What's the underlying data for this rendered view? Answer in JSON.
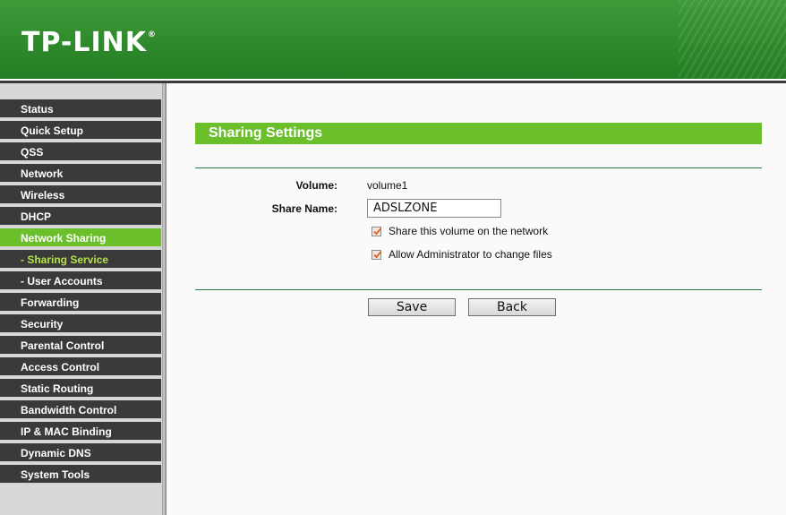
{
  "brand": {
    "logo_text": "TP-LINK",
    "registered": "®"
  },
  "sidebar": {
    "items": [
      {
        "label": "Status"
      },
      {
        "label": "Quick Setup"
      },
      {
        "label": "QSS"
      },
      {
        "label": "Network"
      },
      {
        "label": "Wireless"
      },
      {
        "label": "DHCP"
      },
      {
        "label": "Network Sharing",
        "state": "active"
      },
      {
        "label": "- Sharing Service",
        "state": "selected-sub"
      },
      {
        "label": "- User Accounts"
      },
      {
        "label": "Forwarding"
      },
      {
        "label": "Security"
      },
      {
        "label": "Parental Control"
      },
      {
        "label": "Access Control"
      },
      {
        "label": "Static Routing"
      },
      {
        "label": "Bandwidth Control"
      },
      {
        "label": "IP & MAC Binding"
      },
      {
        "label": "Dynamic DNS"
      },
      {
        "label": "System Tools"
      }
    ]
  },
  "main": {
    "title": "Sharing Settings",
    "volume_label": "Volume:",
    "volume_value": "volume1",
    "share_name_label": "Share Name:",
    "share_name_value": "ADSLZONE",
    "share_volume_checkbox": {
      "label": "Share this volume on the network",
      "checked": true
    },
    "allow_admin_checkbox": {
      "label": "Allow Administrator to change files",
      "checked": true
    },
    "save_label": "Save",
    "back_label": "Back"
  },
  "colors": {
    "header_green": "#2f8a2c",
    "accent_green": "#6bbf2a",
    "nav_dark": "#3a3a3a",
    "sub_active_text": "#b6e24a",
    "checkmark": "#d9622a"
  }
}
